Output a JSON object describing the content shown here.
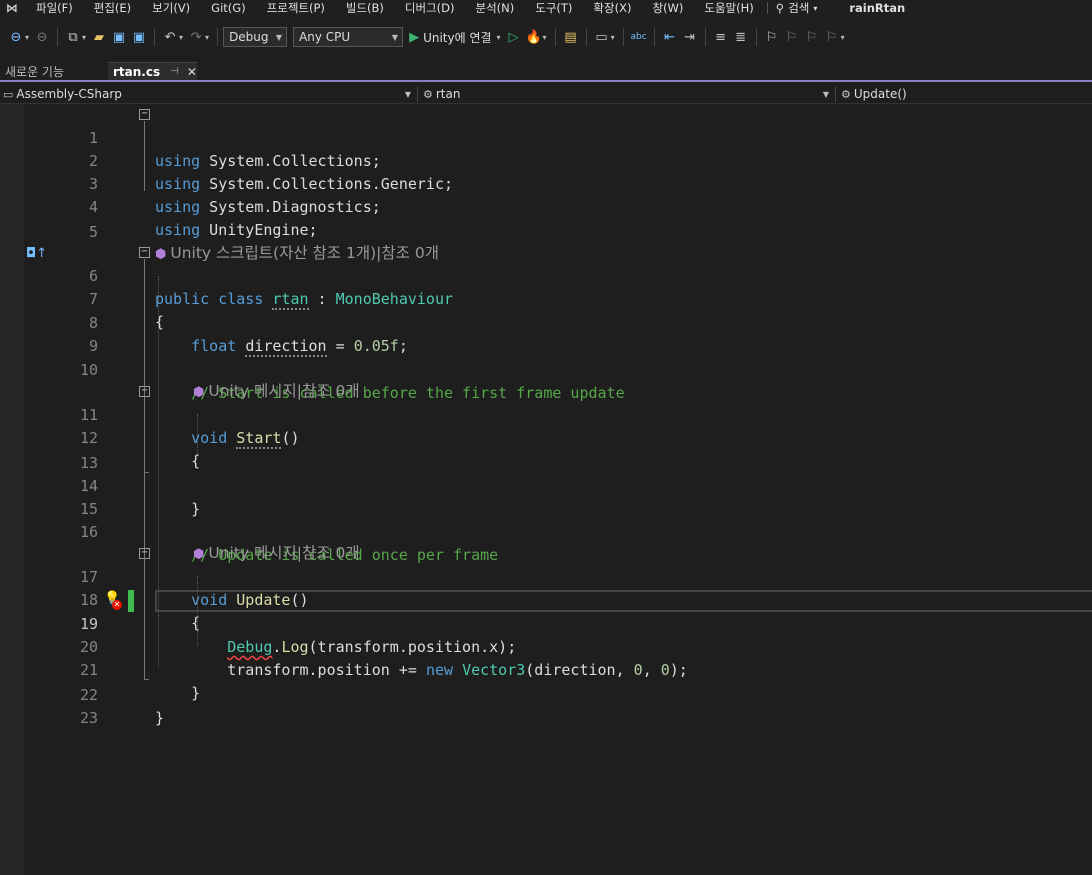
{
  "menu": {
    "items": [
      "파일(F)",
      "편집(E)",
      "보기(V)",
      "Git(G)",
      "프로젝트(P)",
      "빌드(B)",
      "디버그(D)",
      "분석(N)",
      "도구(T)",
      "확장(X)",
      "창(W)",
      "도움말(H)"
    ],
    "search_label": "검색",
    "project_title": "rainRtan"
  },
  "toolbar": {
    "configuration": "Debug",
    "platform": "Any CPU",
    "run_label": "Unity에 연결"
  },
  "tabs": {
    "inactive_label": "새로운 기능",
    "active_label": "rtan.cs"
  },
  "navbar": {
    "project": "Assembly-CSharp",
    "class": "rtan",
    "member": "Update()"
  },
  "editor": {
    "lines": [
      {
        "n": "1",
        "text": "using System.Collections;"
      },
      {
        "n": "2",
        "text": "using System.Collections.Generic;"
      },
      {
        "n": "3",
        "text": "using System.Diagnostics;"
      },
      {
        "n": "4",
        "text": "using UnityEngine;"
      },
      {
        "n": "5",
        "text": ""
      },
      {
        "n": "6",
        "text": "public class rtan : MonoBehaviour"
      },
      {
        "n": "7",
        "text": "{"
      },
      {
        "n": "8",
        "text": "float direction = 0.05f;"
      },
      {
        "n": "9",
        "text": ""
      },
      {
        "n": "10",
        "text": "// Start is called before the first frame update"
      },
      {
        "n": "11",
        "text": "void Start()"
      },
      {
        "n": "12",
        "text": "{"
      },
      {
        "n": "13",
        "text": ""
      },
      {
        "n": "14",
        "text": "}"
      },
      {
        "n": "15",
        "text": ""
      },
      {
        "n": "16",
        "text": "// Update is called once per frame"
      },
      {
        "n": "17",
        "text": "void Update()"
      },
      {
        "n": "18",
        "text": "{"
      },
      {
        "n": "19",
        "text": "Debug.Log(transform.position.x);"
      },
      {
        "n": "20",
        "text": "transform.position += new Vector3(direction, 0, 0);"
      },
      {
        "n": "21",
        "text": "}"
      },
      {
        "n": "22",
        "text": "}"
      },
      {
        "n": "23",
        "text": ""
      }
    ],
    "codelens_class": "Unity 스크립트(자산 참조 1개)|참조 0개",
    "codelens_start": "Unity 메시지|참조 0개",
    "codelens_update": "Unity 메시지|참조 0개"
  },
  "colors": {
    "keyword": "#569cd6",
    "type": "#4ec9b0",
    "comment": "#57a64a",
    "number": "#b5cea8",
    "method": "#dcdcaa",
    "accent": "#8e7cc3"
  },
  "icons": [
    "visual-studio-logo",
    "search-icon",
    "back-icon",
    "forward-icon",
    "new-project-icon",
    "open-icon",
    "save-icon",
    "save-all-icon",
    "undo-icon",
    "redo-icon",
    "play-icon",
    "play-outline-icon",
    "hot-reload-icon",
    "lightbulb-icon",
    "error-icon",
    "cube-icon",
    "bookmark-icon"
  ]
}
